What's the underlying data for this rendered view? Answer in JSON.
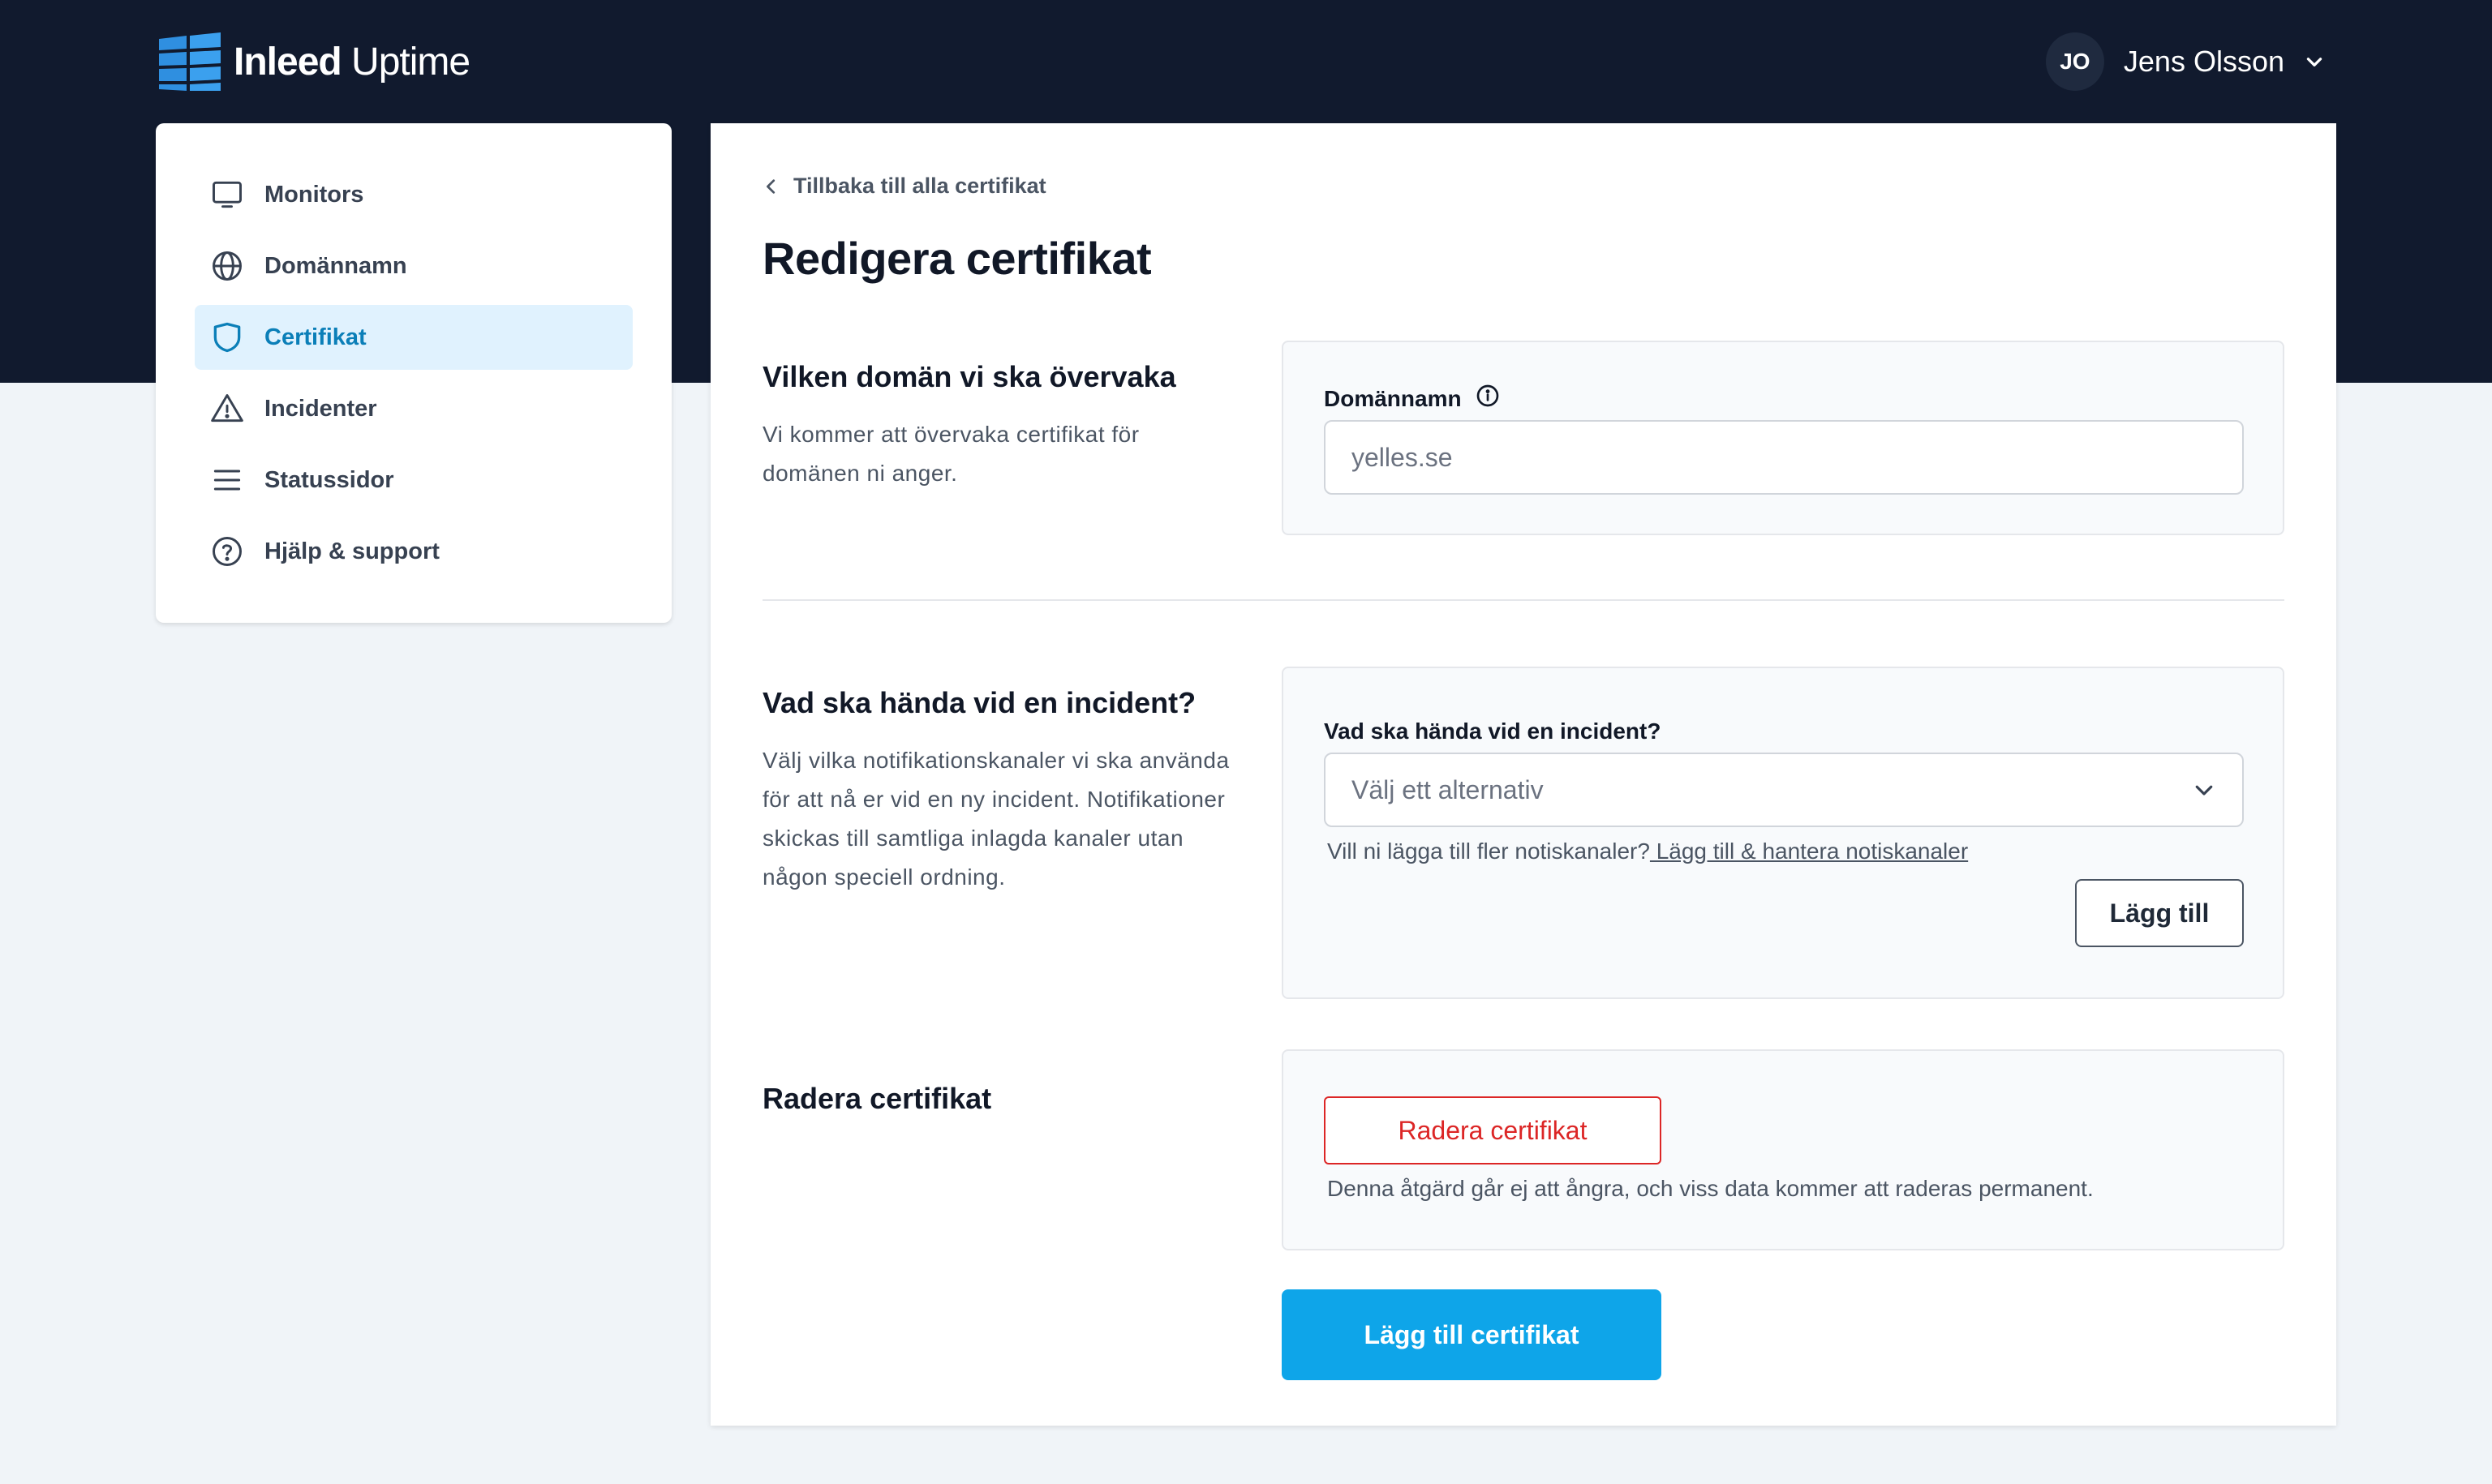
{
  "header": {
    "brand_bold": "Inleed",
    "brand_light": "Uptime",
    "user_initials": "JO",
    "user_name": "Jens Olsson"
  },
  "sidebar": {
    "items": [
      {
        "label": "Monitors",
        "icon": "monitor-icon",
        "active": false
      },
      {
        "label": "Domännamn",
        "icon": "globe-icon",
        "active": false
      },
      {
        "label": "Certifikat",
        "icon": "shield-icon",
        "active": true
      },
      {
        "label": "Incidenter",
        "icon": "warning-icon",
        "active": false
      },
      {
        "label": "Statussidor",
        "icon": "menu-lines-icon",
        "active": false
      },
      {
        "label": "Hjälp & support",
        "icon": "help-circle-icon",
        "active": false
      }
    ]
  },
  "main": {
    "back_link": "Tillbaka till alla certifikat",
    "title": "Redigera certifikat",
    "domain_section": {
      "title": "Vilken domän vi ska övervaka",
      "description": "Vi kommer att övervaka certifikat för domänen ni anger.",
      "field_label": "Domännamn",
      "field_value": "yelles.se"
    },
    "incident_section": {
      "title": "Vad ska hända vid en incident?",
      "description": "Välj vilka notifikationskanaler vi ska använda för att nå er vid en ny incident. Notifikationer skickas till samtliga inlagda kanaler utan någon speciell ordning.",
      "field_label": "Vad ska hända vid en incident?",
      "select_placeholder": "Välj ett alternativ",
      "helper_text": "Vill ni lägga till fler notiskanaler?",
      "helper_link": " Lägg till & hantera notiskanaler",
      "add_button": "Lägg till"
    },
    "delete_section": {
      "title": "Radera certifikat",
      "button": "Radera certifikat",
      "warning": "Denna åtgärd går ej att ångra, och viss data kommer att raderas permanent."
    },
    "submit_button": "Lägg till certifikat"
  },
  "colors": {
    "header_bg": "#111a2e",
    "accent": "#0ea5e9",
    "active_nav_bg": "#e0f2fe",
    "active_nav_text": "#0b7fb8",
    "danger": "#dc2626"
  }
}
